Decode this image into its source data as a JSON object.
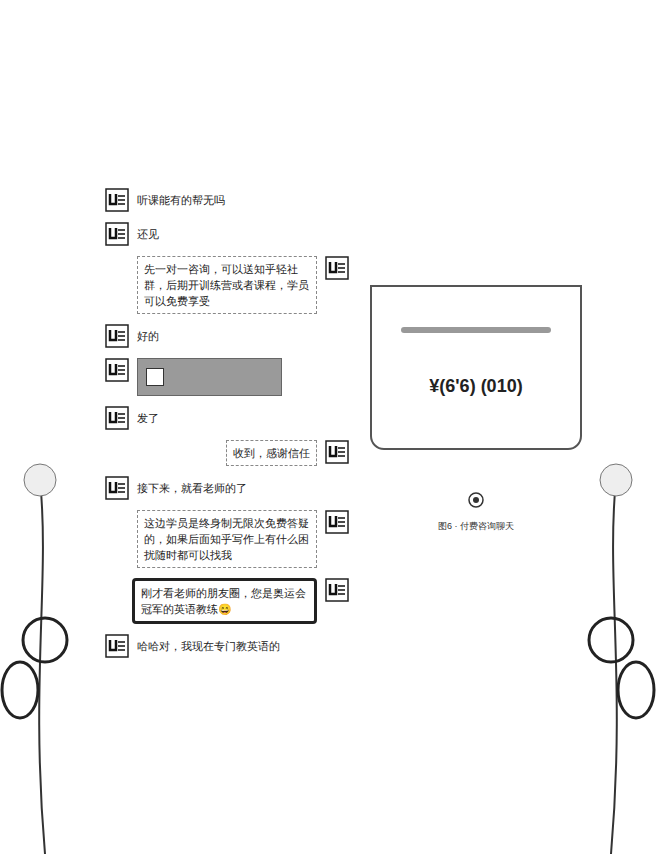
{
  "messages": [
    {
      "side": "left",
      "kind": "text",
      "text": "听课能有的帮无吗",
      "highlighted": false
    },
    {
      "side": "left",
      "kind": "text",
      "text": "还见",
      "highlighted": false
    },
    {
      "side": "right",
      "kind": "text",
      "text": "先一对一咨询，可以送知乎轻社群，后期开训练营或者课程，学员可以免费享受",
      "highlighted": false
    },
    {
      "side": "left",
      "kind": "text",
      "text": "好的",
      "highlighted": false
    },
    {
      "side": "left",
      "kind": "image",
      "text": "",
      "highlighted": false
    },
    {
      "side": "left",
      "kind": "text",
      "text": "发了",
      "highlighted": false
    },
    {
      "side": "right",
      "kind": "text",
      "text": "收到，感谢信任",
      "highlighted": false
    },
    {
      "side": "left",
      "kind": "text",
      "text": "接下来，就看老师的了",
      "highlighted": false
    },
    {
      "side": "right",
      "kind": "text",
      "text": "这边学员是终身制无限次免费答疑的，如果后面知乎写作上有什么困扰随时都可以找我",
      "highlighted": false
    },
    {
      "side": "right",
      "kind": "text",
      "text": "刚才看老师的朋友圈，您是奥运会冠军的英语教练😄",
      "highlighted": true
    },
    {
      "side": "left",
      "kind": "text",
      "text": "哈哈对，我现在专门教英语的",
      "highlighted": false
    }
  ],
  "card": {
    "text": "¥(6'6) (010)",
    "caption": "图6 · 付费咨询聊天"
  }
}
